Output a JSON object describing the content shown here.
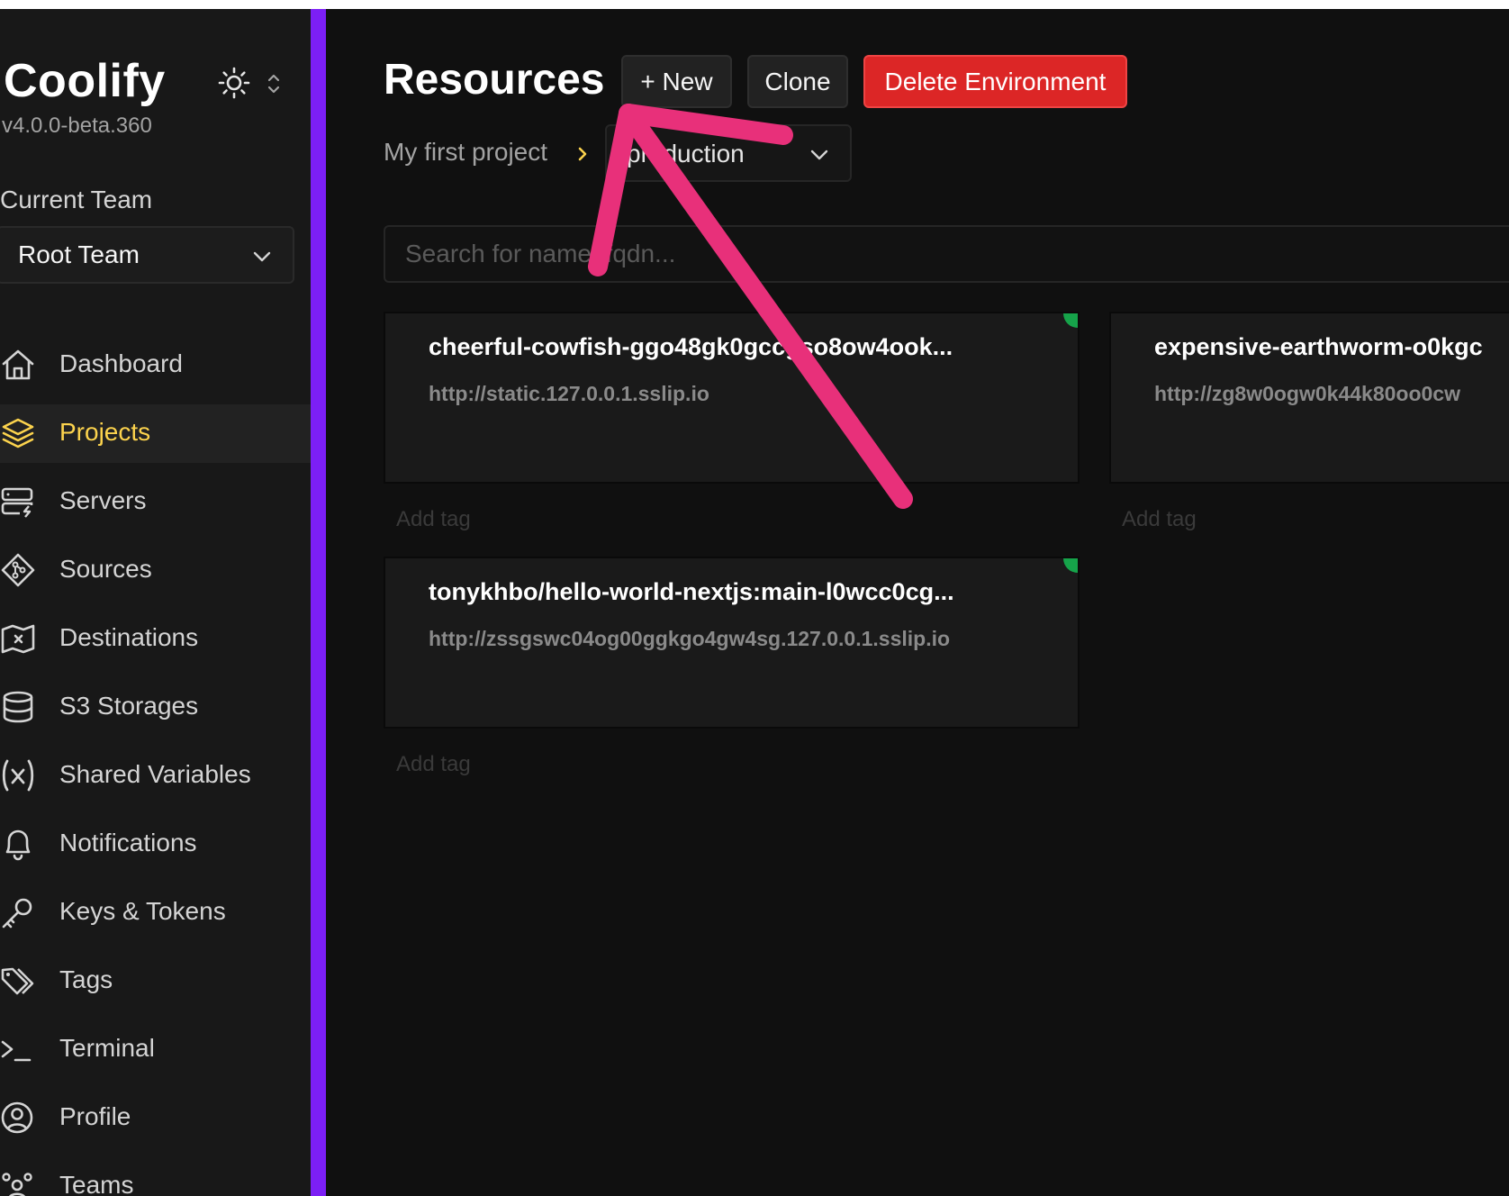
{
  "sidebar": {
    "brand": "Coolify",
    "version": "v4.0.0-beta.360",
    "current_team_label": "Current Team",
    "team_select_value": "Root Team",
    "items": [
      {
        "label": "Dashboard",
        "icon": "home-icon",
        "active": false
      },
      {
        "label": "Projects",
        "icon": "layers-icon",
        "active": true
      },
      {
        "label": "Servers",
        "icon": "server-icon",
        "active": false
      },
      {
        "label": "Sources",
        "icon": "git-branch-icon",
        "active": false
      },
      {
        "label": "Destinations",
        "icon": "docker-icon",
        "active": false
      },
      {
        "label": "S3 Storages",
        "icon": "database-icon",
        "active": false
      },
      {
        "label": "Shared Variables",
        "icon": "variable-icon",
        "active": false
      },
      {
        "label": "Notifications",
        "icon": "bell-icon",
        "active": false
      },
      {
        "label": "Keys & Tokens",
        "icon": "key-icon",
        "active": false
      },
      {
        "label": "Tags",
        "icon": "tags-icon",
        "active": false
      },
      {
        "label": "Terminal",
        "icon": "terminal-icon",
        "active": false
      },
      {
        "label": "Profile",
        "icon": "user-circle-icon",
        "active": false
      },
      {
        "label": "Teams",
        "icon": "users-icon",
        "active": false
      }
    ]
  },
  "header": {
    "title": "Resources",
    "new_button": "+ New",
    "clone_button": "Clone",
    "delete_button": "Delete Environment"
  },
  "breadcrumb": {
    "project": "My first project",
    "environment": "production"
  },
  "search": {
    "placeholder": "Search for name, fqdn..."
  },
  "resources": [
    {
      "title": "cheerful-cowfish-ggo48gk0gccgso8ow4ook...",
      "url": "http://static.127.0.0.1.sslip.io",
      "tag_placeholder": "Add tag",
      "status": "running"
    },
    {
      "title": "expensive-earthworm-o0kgc",
      "url": "http://zg8w0ogw0k44k80oo0cw",
      "tag_placeholder": "Add tag",
      "status": "unknown"
    },
    {
      "title": "tonykhbo/hello-world-nextjs:main-l0wcc0cg...",
      "url": "http://zssgswc04og00ggkgo4gw4sg.127.0.0.1.sslip.io",
      "tag_placeholder": "Add tag",
      "status": "running"
    }
  ],
  "colors": {
    "accent_sidebar_border": "#7c1ff5",
    "active_nav": "#fcd34d",
    "delete_button": "#dc2626",
    "status_running": "#16a34a",
    "annotation_arrow": "#e8307a"
  }
}
